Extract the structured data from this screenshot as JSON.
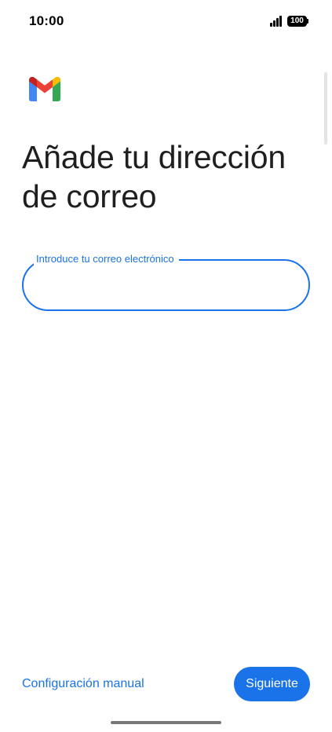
{
  "status_bar": {
    "time": "10:00",
    "battery": "100"
  },
  "app": {
    "logo_icon": "gmail-logo-icon",
    "colors": {
      "accent": "#1a73e8",
      "logo_red": "#ea4335",
      "logo_blue": "#4285f4",
      "logo_green": "#34a853",
      "logo_yellow": "#fbbc04",
      "logo_dark_red": "#c5221f"
    }
  },
  "main": {
    "title": "Añade tu dirección de correo",
    "email_field": {
      "label": "Introduce tu correo electrónico",
      "value": ""
    }
  },
  "footer": {
    "manual_setup_label": "Configuración manual",
    "next_label": "Siguiente"
  }
}
